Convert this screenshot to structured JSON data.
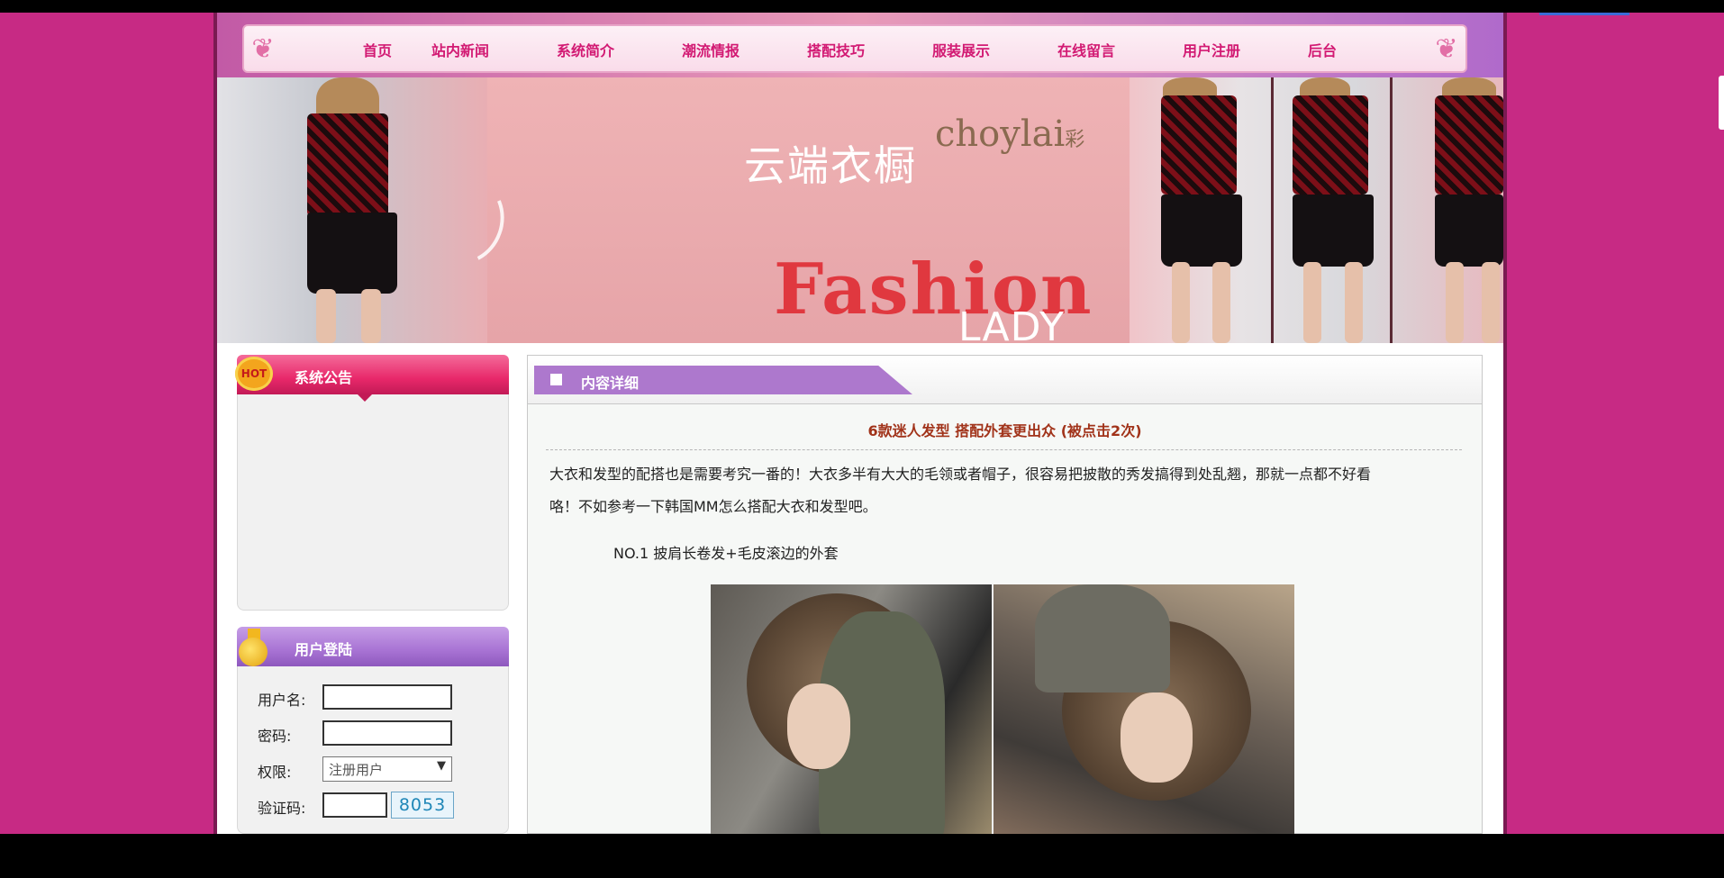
{
  "nav": {
    "items": [
      {
        "label": "首页"
      },
      {
        "label": "站内新闻"
      },
      {
        "label": "系统简介"
      },
      {
        "label": "潮流情报"
      },
      {
        "label": "搭配技巧"
      },
      {
        "label": "服装展示"
      },
      {
        "label": "在线留言"
      },
      {
        "label": "用户注册"
      },
      {
        "label": "后台"
      }
    ]
  },
  "banner": {
    "title_cn": "云端衣橱",
    "brand": "choylai",
    "brand_mark": "彩",
    "fashion": "Fashion",
    "lady": "LADY"
  },
  "sidebar": {
    "notice": {
      "title": "系统公告",
      "badge": "HOT"
    },
    "login": {
      "title": "用户登陆",
      "username_label": "用户名:",
      "password_label": "密码:",
      "role_label": "权限:",
      "role_value": "注册用户",
      "captcha_label": "验证码:",
      "captcha_code": "8053"
    }
  },
  "content": {
    "tab_label": "内容详细",
    "article_title": "6款迷人发型 搭配外套更出众 (被点击2次)",
    "paragraph_line1": "大衣和发型的配搭也是需要考究一番的！大衣多半有大大的毛领或者帽子，很容易把披散的秀发搞得到处乱翘，那就一点都不好看",
    "paragraph_line2": "咯！不如参考一下韩国MM怎么搭配大衣和发型吧。",
    "subheading": "NO.1 披肩长卷发+毛皮滚边的外套"
  },
  "colors": {
    "page_background": "#c72a84",
    "nav_text": "#d21a73",
    "notice_header": "#e8286a",
    "login_header": "#a873d4",
    "content_tab": "#ad78cd",
    "article_title": "#a1331a",
    "captcha_text": "#1e86b7"
  }
}
